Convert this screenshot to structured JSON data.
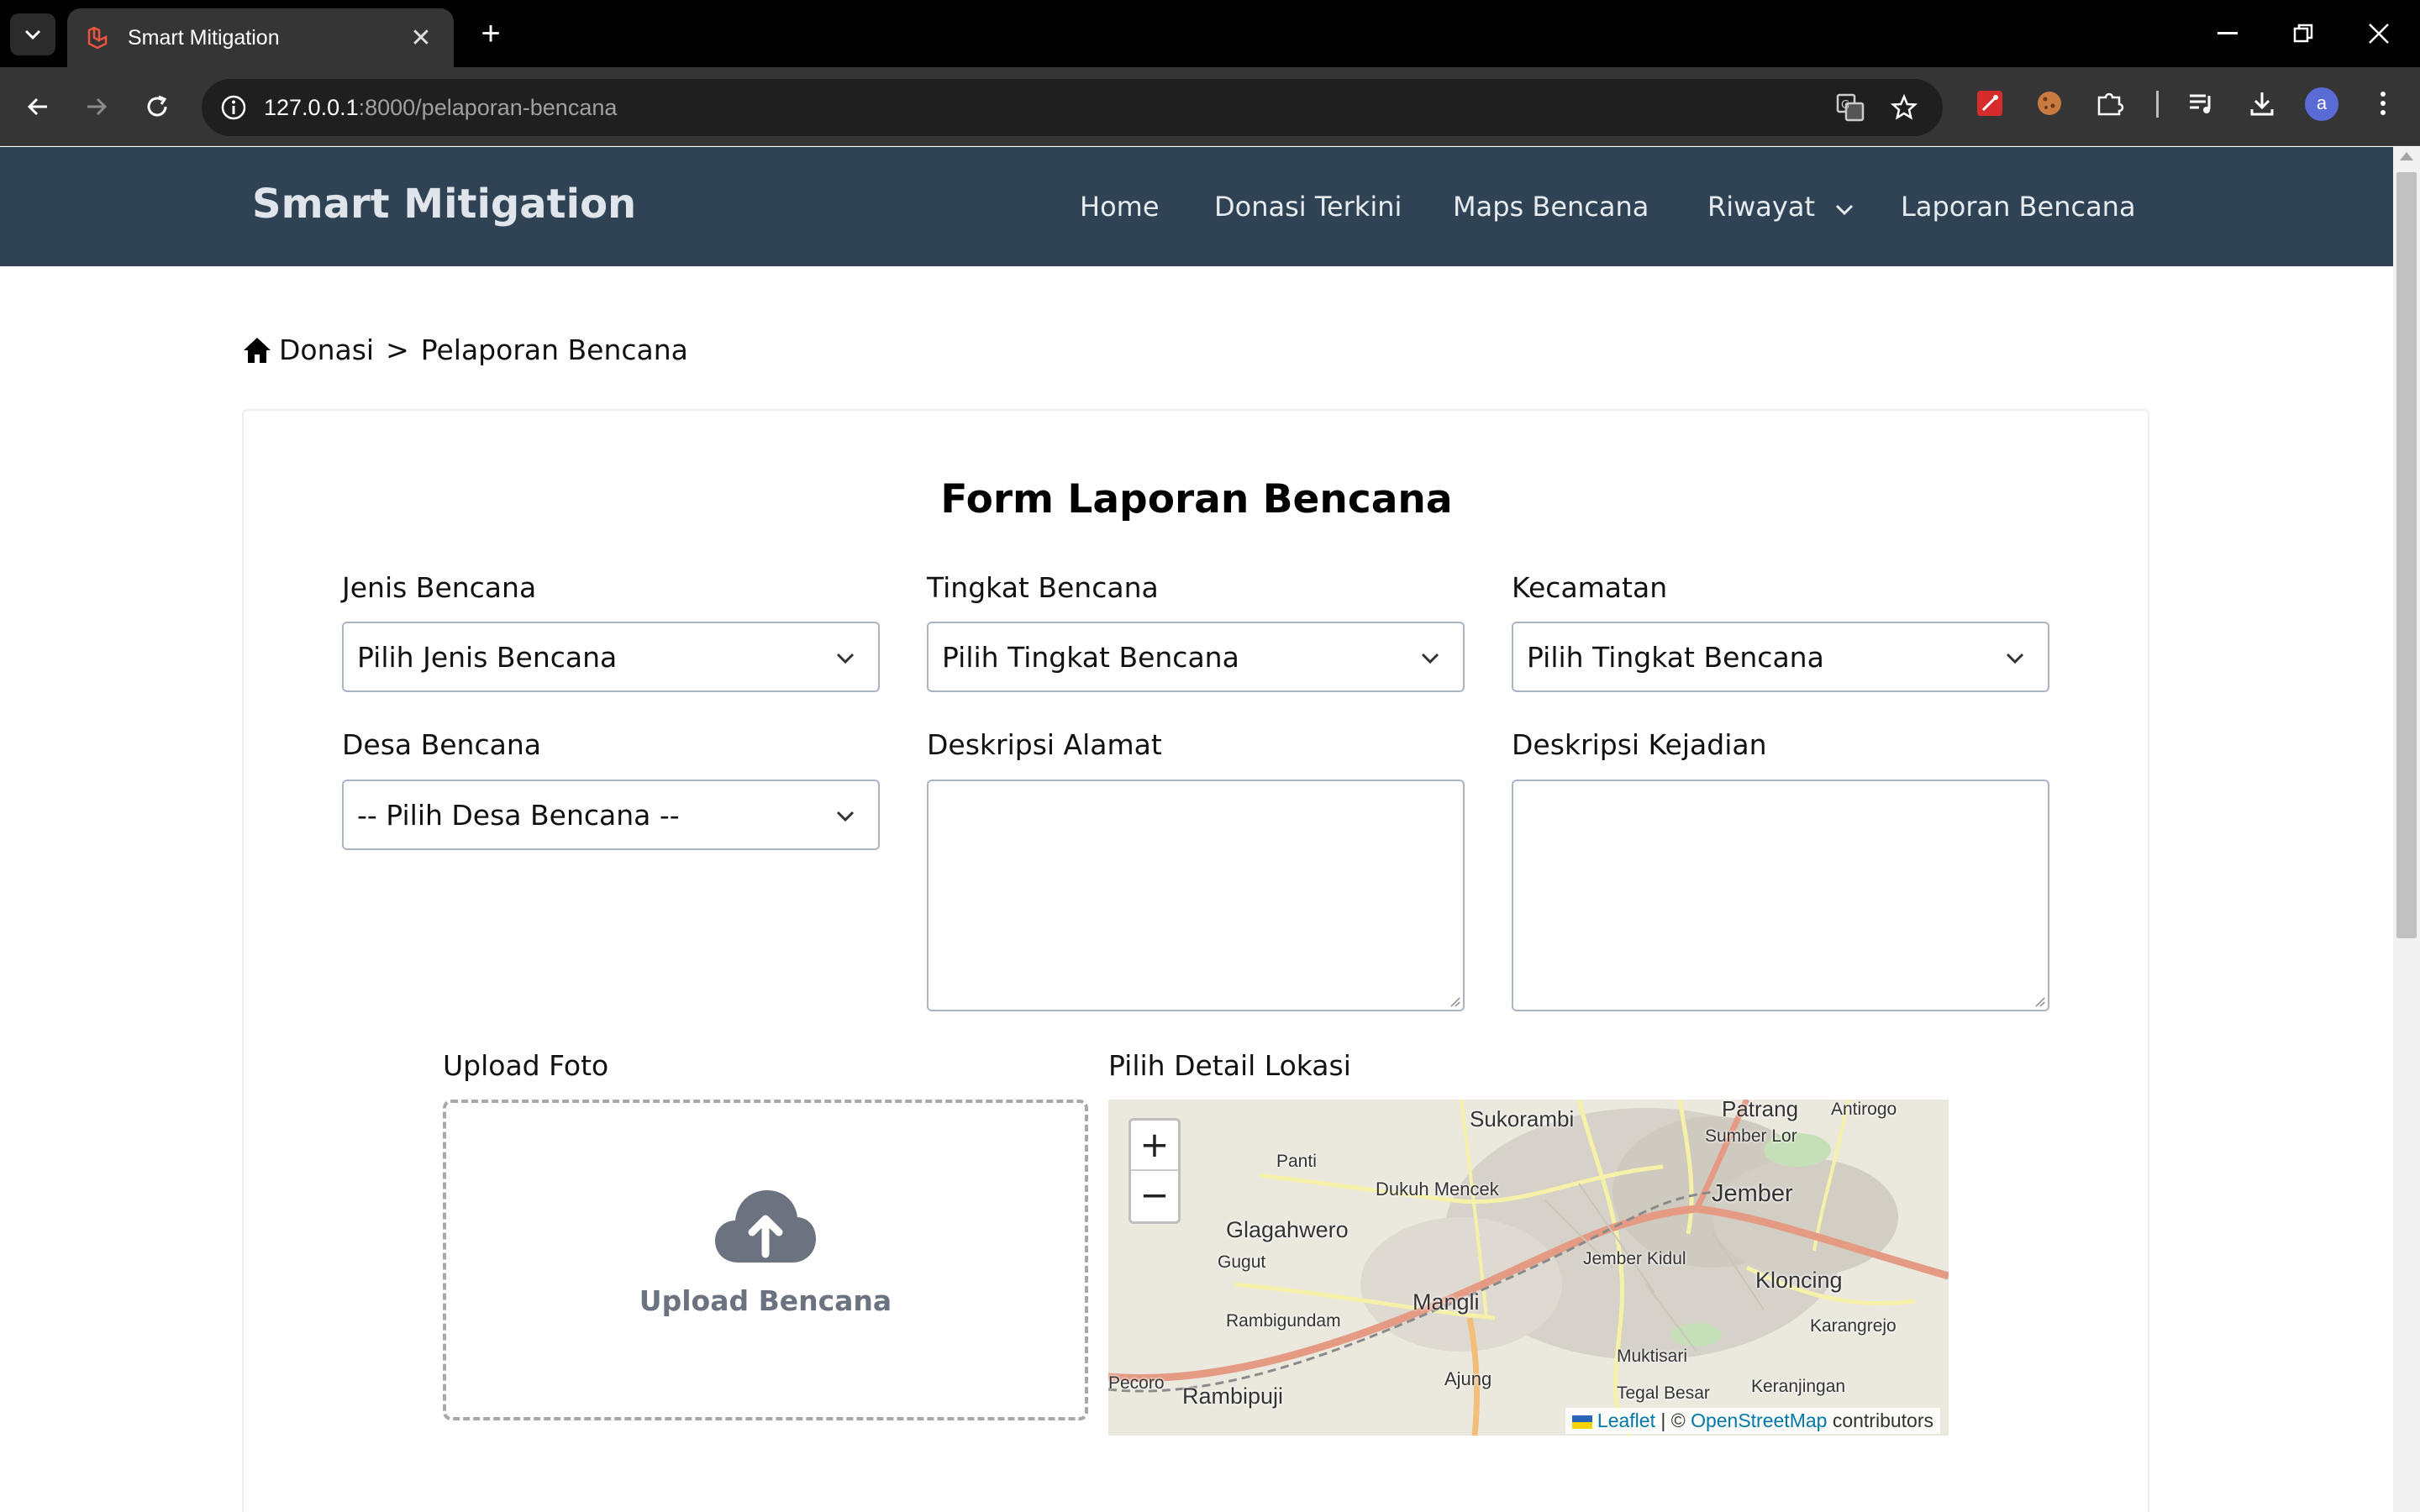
{
  "browser": {
    "tab_title": "Smart Mitigation",
    "url_host": "127.0.0.1",
    "url_path": ":8000/pelaporan-bencana",
    "avatar_letter": "a"
  },
  "site": {
    "brand": "Smart Mitigation",
    "nav": {
      "home": "Home",
      "donasi": "Donasi Terkini",
      "maps": "Maps Bencana",
      "riwayat": "Riwayat",
      "laporan": "Laporan Bencana"
    }
  },
  "breadcrumb": {
    "root": "Donasi",
    "separator": ">",
    "current": "Pelaporan Bencana"
  },
  "form": {
    "title": "Form Laporan Bencana",
    "jenis": {
      "label": "Jenis Bencana",
      "value": "Pilih Jenis Bencana"
    },
    "tingkat": {
      "label": "Tingkat Bencana",
      "value": "Pilih Tingkat Bencana"
    },
    "kecamatan": {
      "label": "Kecamatan",
      "value": "Pilih Tingkat Bencana"
    },
    "desa": {
      "label": "Desa Bencana",
      "value": "-- Pilih Desa Bencana --"
    },
    "alamat": {
      "label": "Deskripsi Alamat",
      "value": ""
    },
    "kejadian": {
      "label": "Deskripsi Kejadian",
      "value": ""
    },
    "upload": {
      "label": "Upload Foto",
      "button": "Upload Bencana"
    },
    "lokasi": {
      "label": "Pilih Detail Lokasi"
    }
  },
  "map": {
    "zoom_in": "+",
    "zoom_out": "−",
    "places": [
      "Sukorambi",
      "Patrang",
      "Antirogo",
      "Sumber Lor",
      "Panti",
      "Dukuh Mencek",
      "Jember",
      "Glagahwero",
      "Gugut",
      "Jember Kidul",
      "Kloncing",
      "Mangli",
      "Rambigundam",
      "Karangrejo",
      "Muktisari",
      "Ajung",
      "Pecoro",
      "Rambipuji",
      "Tegal Besar",
      "Keranjingan"
    ],
    "attribution": {
      "leaflet": "Leaflet",
      "sep": "| ©",
      "osm": "OpenStreetMap",
      "contrib": "contributors"
    }
  },
  "colors": {
    "site_nav_bg": "#2f4354",
    "chrome_bg": "#000000",
    "toolbar_bg": "#353535"
  },
  "icons": [
    "tab-search-icon",
    "laravel-favicon-icon",
    "close-icon",
    "plus-icon",
    "minimize-icon",
    "restore-icon",
    "back-icon",
    "forward-icon",
    "reload-icon",
    "site-info-icon",
    "translate-icon",
    "star-icon",
    "extension-icon",
    "cookie-icon",
    "puzzle-icon",
    "media-icon",
    "download-icon",
    "menu-icon",
    "home-icon",
    "chevron-down-icon",
    "cloud-upload-icon"
  ]
}
